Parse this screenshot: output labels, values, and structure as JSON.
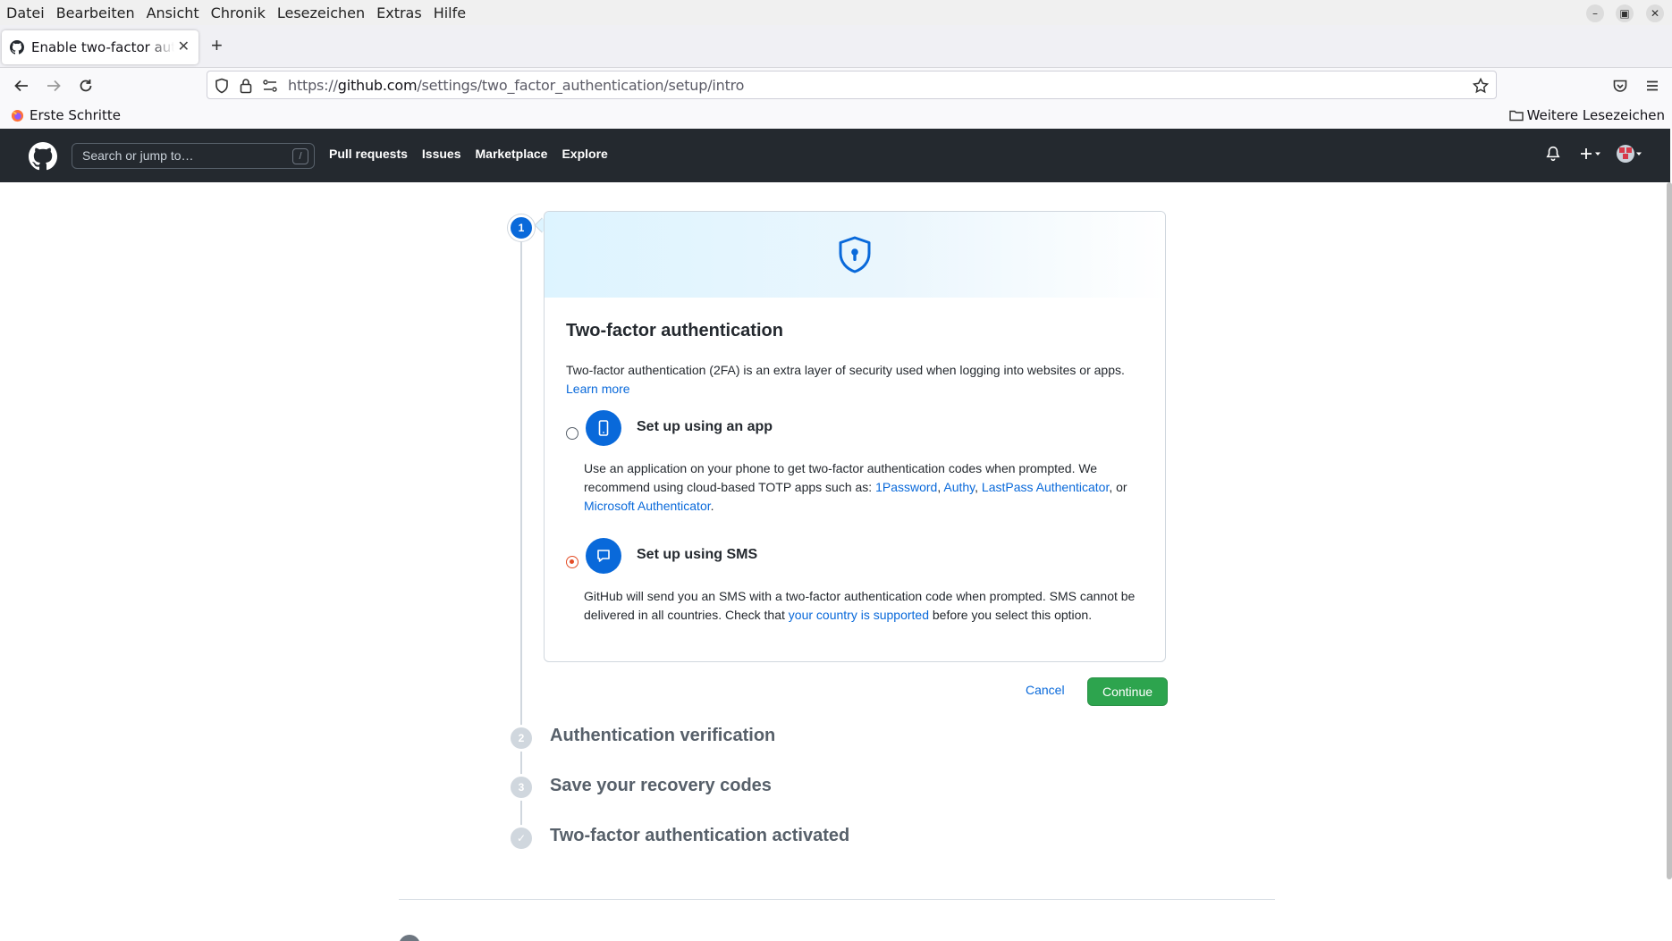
{
  "browser": {
    "menu": [
      "Datei",
      "Bearbeiten",
      "Ansicht",
      "Chronik",
      "Lesezeichen",
      "Extras",
      "Hilfe"
    ],
    "tab_title": "Enable two-factor authentication",
    "url_prefix": "https://",
    "url_domain": "github.com",
    "url_path": "/settings/two_factor_authentication/setup/intro",
    "bookmark_left": "Erste Schritte",
    "bookmark_right": "Weitere Lesezeichen"
  },
  "github_header": {
    "search_placeholder": "Search or jump to…",
    "search_shortcut": "/",
    "nav": [
      "Pull requests",
      "Issues",
      "Marketplace",
      "Explore"
    ]
  },
  "steps": [
    {
      "number": "1",
      "title": ""
    },
    {
      "number": "2",
      "title": "Authentication verification"
    },
    {
      "number": "3",
      "title": "Save your recovery codes"
    },
    {
      "number": "✓",
      "title": "Two-factor authentication activated"
    }
  ],
  "card": {
    "title": "Two-factor authentication",
    "description": "Two-factor authentication (2FA) is an extra layer of security used when logging into websites or apps.",
    "learn_more": "Learn more",
    "app_option": {
      "title": "Set up using an app",
      "desc_start": "Use an application on your phone to get two-factor authentication codes when prompted. We recommend using cloud-based TOTP apps such as: ",
      "apps": [
        "1Password",
        "Authy",
        "LastPass Authenticator",
        "Microsoft Authenticator"
      ],
      "sep1": ", ",
      "sep2": ", ",
      "sep3": ", or ",
      "desc_end": ".",
      "selected": false
    },
    "sms_option": {
      "title": "Set up using SMS",
      "desc_start": "GitHub will send you an SMS with a two-factor authentication code when prompted. SMS cannot be delivered in all countries. Check that ",
      "link": "your country is supported",
      "desc_end": " before you select this option.",
      "selected": true
    }
  },
  "actions": {
    "cancel": "Cancel",
    "continue": "Continue"
  },
  "colors": {
    "accent_blue": "#0969da",
    "continue_green": "#2da44e",
    "header_bg": "#24292f",
    "radio_checked": "#e34c26"
  }
}
